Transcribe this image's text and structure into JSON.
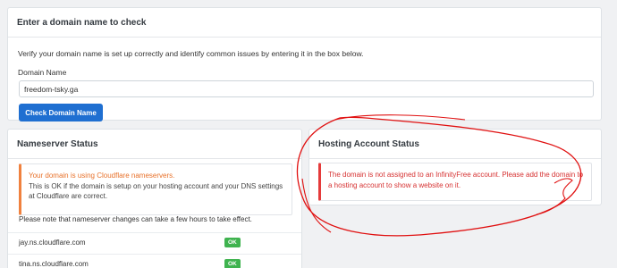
{
  "domain_check": {
    "title": "Enter a domain name to check",
    "description": "Verify your domain name is set up correctly and identify common issues by entering it in the box below.",
    "field_label": "Domain Name",
    "field_value": "freedom-tsky.ga",
    "button_label": "Check Domain Name",
    "button_color": "#1f6fd1"
  },
  "nameserver_status": {
    "title": "Nameserver Status",
    "alert_title": "Your domain is using Cloudflare nameservers.",
    "alert_body": "This is OK if the domain is setup on your hosting account and your DNS settings at Cloudflare are correct.",
    "alert_color": "#f0813e",
    "note": "Please note that nameserver changes can take a few hours to take effect.",
    "nameservers": [
      {
        "name": "jay.ns.cloudflare.com",
        "status": "OK"
      },
      {
        "name": "tina.ns.cloudflare.com",
        "status": "OK"
      }
    ],
    "ok_color": "#3fb34f"
  },
  "hosting_status": {
    "title": "Hosting Account Status",
    "alert_text": "The domain is not assigned to an InfinityFree account. Please add the domain to a hosting account to show a website on it.",
    "alert_color": "#e53b3b"
  },
  "annotation": {
    "color": "#e01010"
  }
}
